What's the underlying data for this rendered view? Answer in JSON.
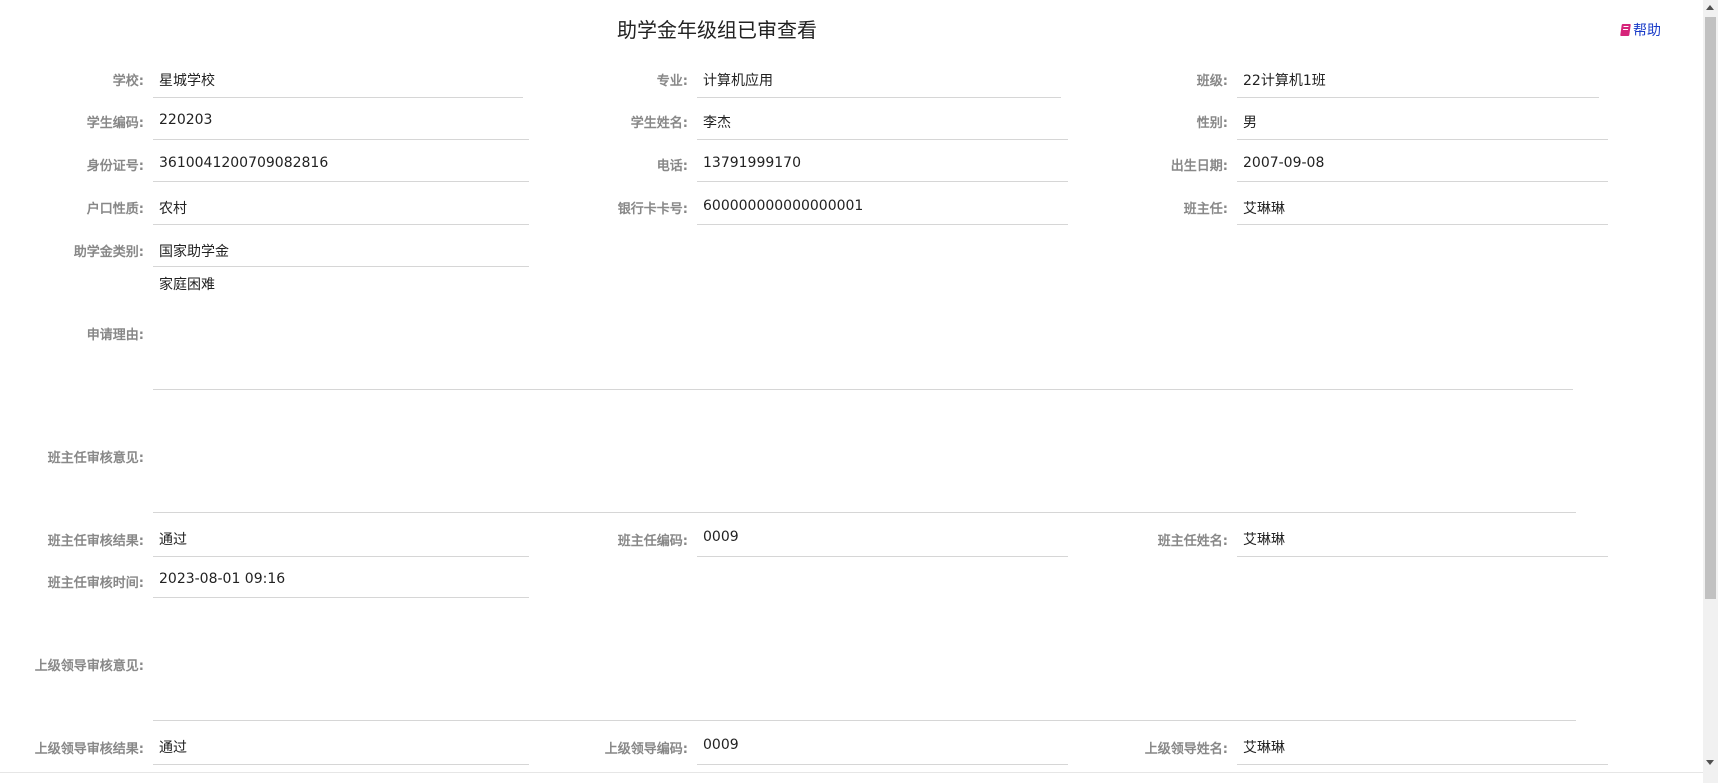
{
  "header": {
    "title": "助学金年级组已审查看",
    "help_label": "帮助"
  },
  "fields": {
    "school": {
      "label": "学校:",
      "value": "星城学校"
    },
    "major": {
      "label": "专业:",
      "value": "计算机应用"
    },
    "class": {
      "label": "班级:",
      "value": "22计算机1班"
    },
    "student_code": {
      "label": "学生编码:",
      "value": "220203"
    },
    "student_name": {
      "label": "学生姓名:",
      "value": "李杰"
    },
    "gender": {
      "label": "性别:",
      "value": "男"
    },
    "id_number": {
      "label": "身份证号:",
      "value": "361004120070908281 6"
    },
    "phone": {
      "label": "电话:",
      "value": "13791999170"
    },
    "birth_date": {
      "label": "出生日期:",
      "value": "2007-09-08"
    },
    "household_type": {
      "label": "户口性质:",
      "value": "农村"
    },
    "bank_card": {
      "label": "银行卡卡号:",
      "value": "600000000000000001"
    },
    "head_teacher": {
      "label": "班主任:",
      "value": "艾琳琳"
    },
    "grant_category": {
      "label": "助学金类别:",
      "value": "国家助学金"
    },
    "apply_reason": {
      "label": "申请理由:",
      "value": "家庭困难"
    },
    "teacher_opinion": {
      "label": "班主任审核意见:",
      "value": ""
    },
    "teacher_result": {
      "label": "班主任审核结果:",
      "value": "通过"
    },
    "teacher_code": {
      "label": "班主任编码:",
      "value": "0009"
    },
    "teacher_name": {
      "label": "班主任姓名:",
      "value": "艾琳琳"
    },
    "teacher_time": {
      "label": "班主任审核时间:",
      "value": "2023-08-01 09:16"
    },
    "leader_opinion": {
      "label": "上级领导审核意见:",
      "value": ""
    },
    "leader_result": {
      "label": "上级领导审核结果:",
      "value": "通过"
    },
    "leader_code": {
      "label": "上级领导编码:",
      "value": "0009"
    },
    "leader_name": {
      "label": "上级领导姓名:",
      "value": "艾琳琳"
    }
  }
}
